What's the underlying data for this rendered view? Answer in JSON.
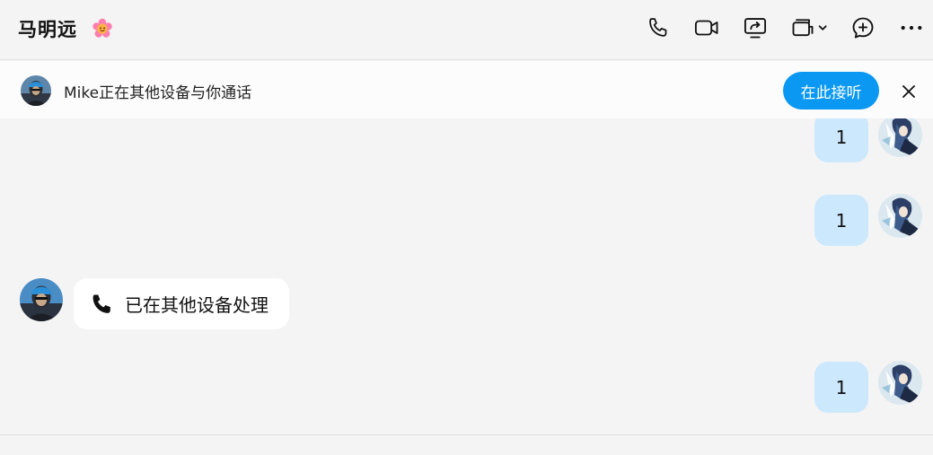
{
  "header": {
    "title": "马明远",
    "icons": [
      "phone-icon",
      "video-icon",
      "screen-share-icon",
      "multi-device-icon",
      "add-chat-icon",
      "more-icon"
    ]
  },
  "banner": {
    "text": "Mike正在其他设备与你通话",
    "answer_label": "在此接听"
  },
  "messages": [
    {
      "direction": "out",
      "text": "1"
    },
    {
      "direction": "out",
      "text": "1"
    },
    {
      "direction": "in",
      "type": "call",
      "text": "已在其他设备处理",
      "icon": "phone-icon"
    },
    {
      "direction": "out",
      "text": "1"
    }
  ],
  "colors": {
    "accent": "#0a98f2",
    "outgoing_bubble": "#cbe8fd",
    "background": "#f4f4f4"
  }
}
